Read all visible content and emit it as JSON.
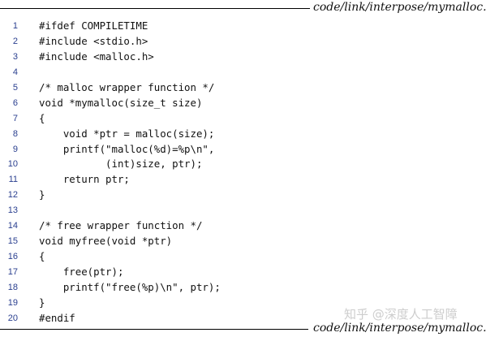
{
  "header": {
    "path": "code/link/interpose/mymalloc.c"
  },
  "footer": {
    "path": "code/link/interpose/mymalloc.c"
  },
  "code": {
    "lines": [
      {
        "num": "1",
        "text": "#ifdef COMPILETIME"
      },
      {
        "num": "2",
        "text": "#include <stdio.h>"
      },
      {
        "num": "3",
        "text": "#include <malloc.h>"
      },
      {
        "num": "4",
        "text": ""
      },
      {
        "num": "5",
        "text": "/* malloc wrapper function */"
      },
      {
        "num": "6",
        "text": "void *mymalloc(size_t size)"
      },
      {
        "num": "7",
        "text": "{"
      },
      {
        "num": "8",
        "text": "    void *ptr = malloc(size);"
      },
      {
        "num": "9",
        "text": "    printf(\"malloc(%d)=%p\\n\","
      },
      {
        "num": "10",
        "text": "           (int)size, ptr);"
      },
      {
        "num": "11",
        "text": "    return ptr;"
      },
      {
        "num": "12",
        "text": "}"
      },
      {
        "num": "13",
        "text": ""
      },
      {
        "num": "14",
        "text": "/* free wrapper function */"
      },
      {
        "num": "15",
        "text": "void myfree(void *ptr)"
      },
      {
        "num": "16",
        "text": "{"
      },
      {
        "num": "17",
        "text": "    free(ptr);"
      },
      {
        "num": "18",
        "text": "    printf(\"free(%p)\\n\", ptr);"
      },
      {
        "num": "19",
        "text": "}"
      },
      {
        "num": "20",
        "text": "#endif"
      }
    ]
  },
  "watermark": {
    "text": "知乎 @深度人工智障"
  }
}
